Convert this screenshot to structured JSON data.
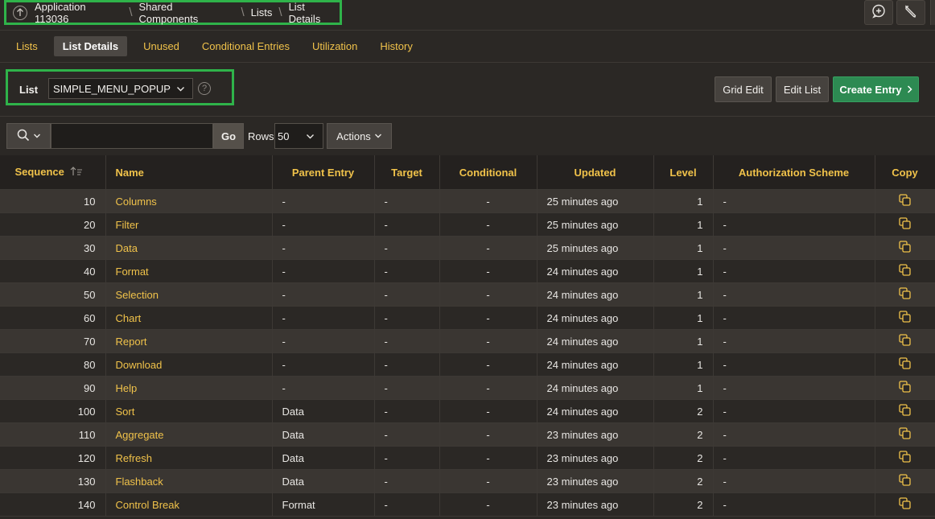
{
  "breadcrumb": {
    "items": [
      "Application 113036",
      "Shared Components",
      "Lists",
      "List Details"
    ]
  },
  "tabs": [
    "Lists",
    "List Details",
    "Unused",
    "Conditional Entries",
    "Utilization",
    "History"
  ],
  "list_selector": {
    "label": "List",
    "value": "SIMPLE_MENU_POPUP",
    "help": "?"
  },
  "buttons": {
    "grid_edit": "Grid Edit",
    "edit_list": "Edit List",
    "create_entry": "Create Entry"
  },
  "toolbar": {
    "go": "Go",
    "rows_label": "Rows",
    "rows_value": "50",
    "actions": "Actions"
  },
  "table": {
    "columns": [
      "Sequence",
      "Name",
      "Parent Entry",
      "Target",
      "Conditional",
      "Updated",
      "Level",
      "Authorization Scheme",
      "Copy"
    ],
    "rows": [
      [
        "10",
        "Columns",
        "-",
        "-",
        "-",
        "25 minutes ago",
        "1",
        "-"
      ],
      [
        "20",
        "Filter",
        "-",
        "-",
        "-",
        "25 minutes ago",
        "1",
        "-"
      ],
      [
        "30",
        "Data",
        "-",
        "-",
        "-",
        "25 minutes ago",
        "1",
        "-"
      ],
      [
        "40",
        "Format",
        "-",
        "-",
        "-",
        "24 minutes ago",
        "1",
        "-"
      ],
      [
        "50",
        "Selection",
        "-",
        "-",
        "-",
        "24 minutes ago",
        "1",
        "-"
      ],
      [
        "60",
        "Chart",
        "-",
        "-",
        "-",
        "24 minutes ago",
        "1",
        "-"
      ],
      [
        "70",
        "Report",
        "-",
        "-",
        "-",
        "24 minutes ago",
        "1",
        "-"
      ],
      [
        "80",
        "Download",
        "-",
        "-",
        "-",
        "24 minutes ago",
        "1",
        "-"
      ],
      [
        "90",
        "Help",
        "-",
        "-",
        "-",
        "24 minutes ago",
        "1",
        "-"
      ],
      [
        "100",
        "Sort",
        "Data",
        "-",
        "-",
        "24 minutes ago",
        "2",
        "-"
      ],
      [
        "110",
        "Aggregate",
        "Data",
        "-",
        "-",
        "23 minutes ago",
        "2",
        "-"
      ],
      [
        "120",
        "Refresh",
        "Data",
        "-",
        "-",
        "23 minutes ago",
        "2",
        "-"
      ],
      [
        "130",
        "Flashback",
        "Data",
        "-",
        "-",
        "23 minutes ago",
        "2",
        "-"
      ],
      [
        "140",
        "Control Break",
        "Format",
        "-",
        "-",
        "23 minutes ago",
        "2",
        "-"
      ]
    ]
  },
  "colors": {
    "accent": "#f0c24a",
    "primary_button": "#2d8a52",
    "highlight_border": "#2fb34a"
  }
}
